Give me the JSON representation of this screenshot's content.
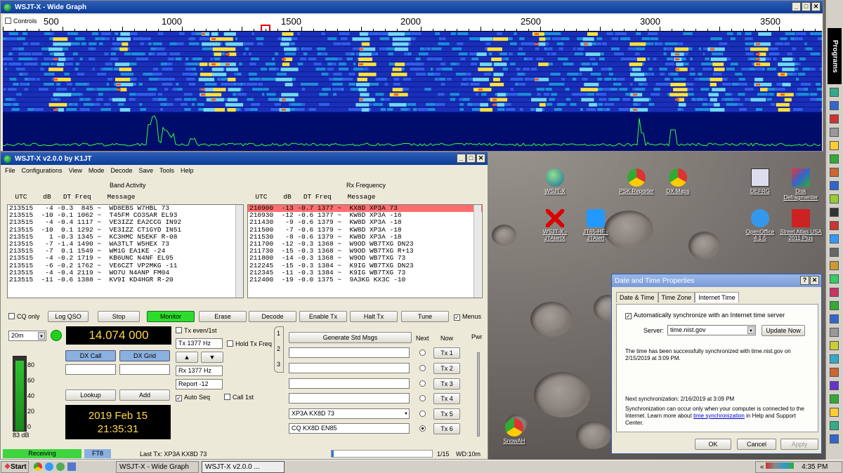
{
  "wide_graph": {
    "title": "WSJT-X - Wide Graph",
    "controls_label": "Controls",
    "freq_ticks": [
      "500",
      "1000",
      "1500",
      "2000",
      "2500",
      "3000",
      "3500"
    ]
  },
  "main": {
    "title": "WSJT-X   v2.0.0   by K1JT",
    "menu": [
      "File",
      "Configurations",
      "View",
      "Mode",
      "Decode",
      "Save",
      "Tools",
      "Help"
    ],
    "band_activity": {
      "label": "Band Activity",
      "header": "  UTC    dB   DT Freq    Message",
      "rows": [
        "213515   -4 -0.3  845 ~  WD8EBS W7HBL 73",
        "213515  -10 -0.1 1062 ~  T45FM CO3SAR EL93",
        "213515   -4 -0.4 1117 ~  VE3IZZ EA2CCG IN92",
        "213515  -10  0.1 1292 ~  VE3IZZ CT1GYD IN51",
        "213515    1 -0.3 1345 ~  KC3HMC N5EKF R-08",
        "213515   -7 -1.4 1490 ~  WA3TLT W5HEX 73",
        "213515   -7  0.1 1549 ~  WM1G EA1KE -24",
        "213515   -4 -0.2 1719 ~  KB6UNC N4NF EL95",
        "213515   -6 -0.2 1762 ~  VE6CZT VP2MKG -11",
        "213515   -4 -0.4 2119 ~  WO7U N4ANP FM04",
        "213515  -11 -0.6 1388 ~  KV9I KD4HGR R-20"
      ]
    },
    "rx_frequency": {
      "label": "Rx Frequency",
      "header": "  UTC    dB   DT Freq    Message",
      "rows": [
        "210900  -13 -0.7 1377 ~  KX8D XP3A 73",
        "210930  -12 -0.6 1377 ~  KW8D XP3A -16",
        "211430   -9 -0.6 1379 ~  KW8D XP3A -18",
        "211500   -7 -0.6 1379 ~  KW8D XP3A -18",
        "211530   -8 -0.6 1379 ~  KW8D XP3A -18",
        "211700  -12 -0.3 1368 ~  W9OD WB7TXG DN23",
        "211730  -15 -0.3 1368 ~  W9OD WB7TXG R+13",
        "211800  -14 -0.3 1368 ~  W9OD WB7TXG 73",
        "212245  -15 -0.3 1384 ~  K9IG WB7TXG DN23",
        "212345  -11 -0.3 1384 ~  K9IG WB7TXG 73",
        "212400  -19 -0.0 1375 ~  9A3KG KX3C -10"
      ]
    },
    "controls": {
      "cq_only": "CQ only",
      "log_qso": "Log QSO",
      "stop": "Stop",
      "monitor": "Monitor",
      "erase": "Erase",
      "decode": "Decode",
      "enable_tx": "Enable Tx",
      "halt_tx": "Halt Tx",
      "tune": "Tune",
      "menus": "Menus"
    },
    "band": "20m",
    "frequency": "14.074 000",
    "dx_call": "DX Call",
    "dx_grid": "DX Grid",
    "lookup": "Lookup",
    "add": "Add",
    "date": "2019 Feb 15",
    "time": "21:35:31",
    "meter_db": "83 dB",
    "meter_ticks": [
      "80",
      "60",
      "40",
      "20",
      "0"
    ],
    "tx_even": "Tx even/1st",
    "tx_hz": "Tx  1377 Hz",
    "hold_tx": "Hold Tx Freq",
    "rx_hz": "Rx  1377 Hz",
    "report": "Report -12",
    "auto_seq": "Auto Seq",
    "call_1st": "Call 1st",
    "gen_std": "Generate Std Msgs",
    "next": "Next",
    "now": "Now",
    "pwr": "Pwr",
    "tx_msgs": [
      "",
      "",
      "",
      "",
      "XP3A KX8D 73",
      "CQ KX8D EN85"
    ],
    "tx_buttons": [
      "Tx 1",
      "Tx 2",
      "Tx 3",
      "Tx 4",
      "Tx 5",
      "Tx 6"
    ],
    "tab_labels": [
      "1",
      "2",
      "3"
    ],
    "status": {
      "receiving": "Receiving",
      "mode": "FT8",
      "last_tx": "Last Tx: XP3A KX8D 73",
      "page": "1/15",
      "wd": "WD:10m"
    }
  },
  "dialog": {
    "title": "Date and Time Properties",
    "tabs": [
      "Date & Time",
      "Time Zone",
      "Internet Time"
    ],
    "auto_sync": "Automatically synchronize with an Internet time server",
    "server_label": "Server:",
    "server": "time.nist.gov",
    "update_now": "Update Now",
    "success": "The time has been successfully synchronized with time.nist.gov on 2/15/2019 at 3:09 PM.",
    "next_sync": "Next synchronization: 2/16/2019 at 3:09 PM",
    "info_a": "Synchronization can occur only when your computer is connected to the Internet.  Learn more about ",
    "info_link": "time synchronization",
    "info_b": " in Help and Support Center.",
    "ok": "OK",
    "cancel": "Cancel",
    "apply": "Apply"
  },
  "desktop_icons": [
    "WSJT-X",
    "PSK Reporter",
    "DX Maps",
    "DEFRG",
    "Disk Defragmenter",
    "WSJT-X - JTAlertX",
    "JT65-HF - JTAlert",
    "OpenOffice 4.1.5",
    "Street Atlas USA 2011 Plus",
    "SnowAH"
  ],
  "taskbar": {
    "start": "Start",
    "items": [
      "WSJT-X - Wide Graph",
      "WSJT-X   v2.0.0   ..."
    ],
    "clock": "4:35 PM"
  },
  "sidebar": {
    "programs": "Programs"
  }
}
